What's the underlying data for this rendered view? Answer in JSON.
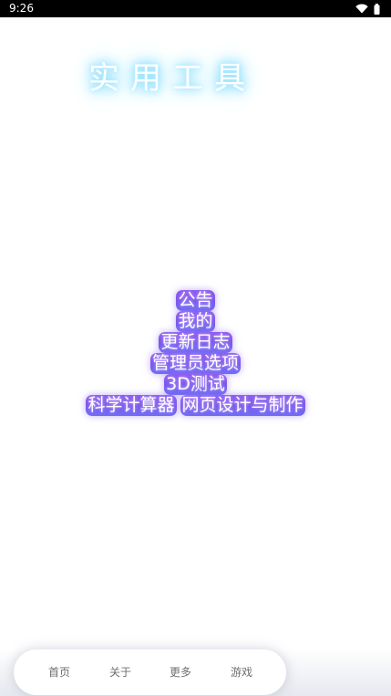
{
  "status_bar": {
    "time": "9:26",
    "icons": [
      "wifi-icon",
      "battery-icon"
    ]
  },
  "app": {
    "title": "实用工具"
  },
  "menu": {
    "items": [
      "公告",
      "我的",
      "更新日志",
      "管理员选项",
      "3D测试",
      "科学计算器",
      "网页设计与制作"
    ]
  },
  "bottom_nav": {
    "items": [
      "首页",
      "关于",
      "更多",
      "游戏"
    ]
  },
  "colors": {
    "title_glow": "#7fdcff",
    "menu_gradient_top": "#8f5cf0",
    "menu_gradient_bottom": "#6f6cf5",
    "nav_text": "#6f6f6f"
  }
}
